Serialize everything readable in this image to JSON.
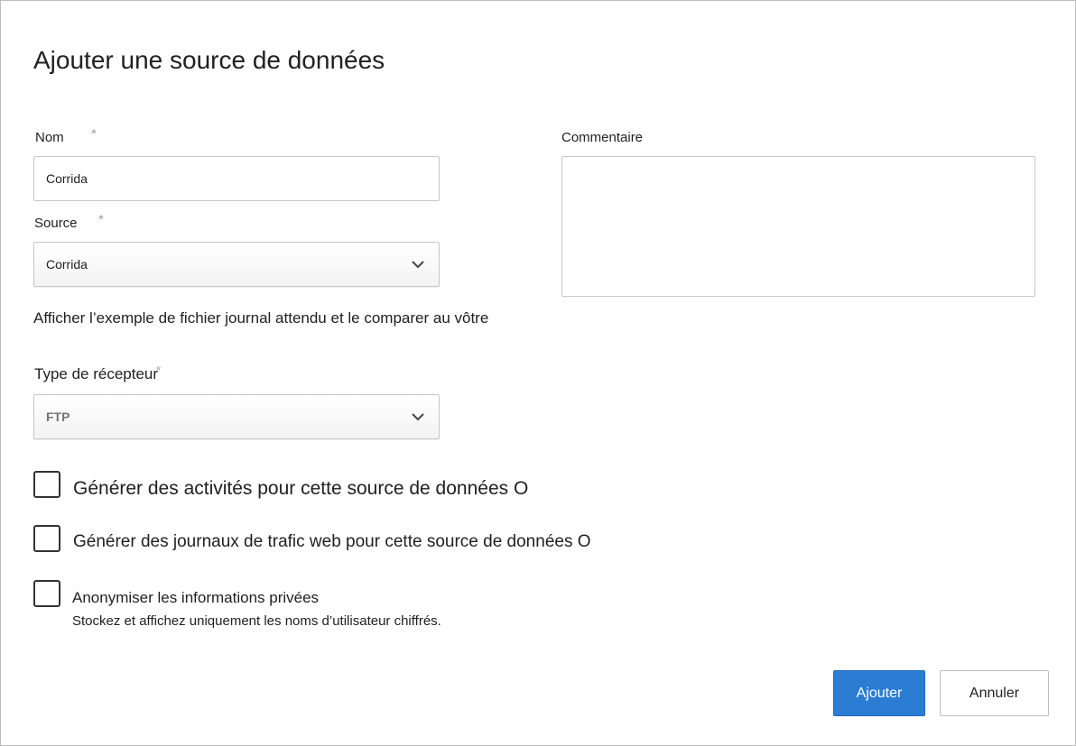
{
  "dialog": {
    "title": "Ajouter une source de données"
  },
  "form": {
    "name": {
      "label": "Nom",
      "required_mark": "*",
      "value": "Corrida"
    },
    "source": {
      "label": "Source",
      "required_mark": "*",
      "value": "Corrida"
    },
    "sample_text": "Afficher l’exemple de fichier journal attendu et le comparer au vôtre",
    "receiver": {
      "label": "Type de récepteur",
      "required_mark": "*",
      "value": "FTP"
    },
    "comment": {
      "label": "Commentaire",
      "value": ""
    }
  },
  "options": [
    {
      "label": "Générer des activités pour cette source de données O",
      "checked": false
    },
    {
      "label": "Générer des journaux de trafic web pour cette source de données O",
      "checked": false
    },
    {
      "label": "Anonymiser les informations privées",
      "description": "Stockez et affichez uniquement les noms d’utilisateur chiffrés.",
      "checked": false
    }
  ],
  "buttons": {
    "add": "Ajouter",
    "cancel": "Annuler"
  },
  "colors": {
    "primary": "#2b7cd3",
    "border": "#c8c8c8"
  },
  "icons": {
    "dropdown": "chevron-down-icon"
  }
}
